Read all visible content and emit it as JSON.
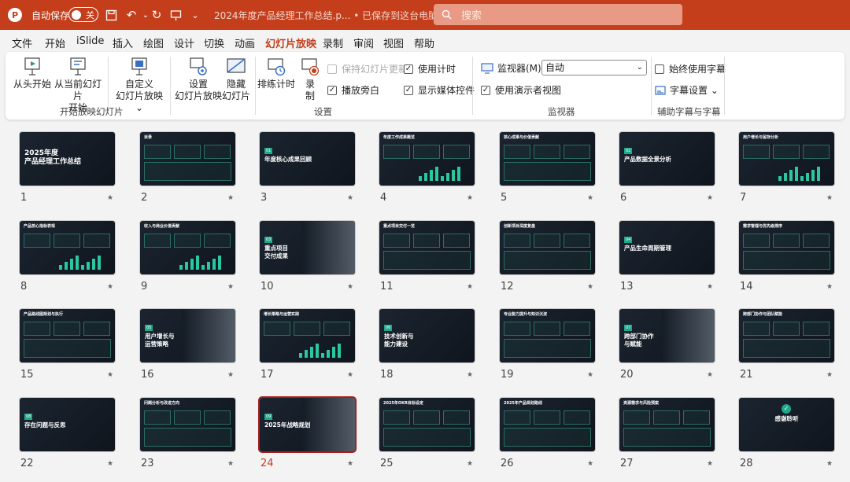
{
  "titlebar": {
    "autosave_label": "自动保存",
    "toggle_state": "关",
    "doc_title": "2024年度产品经理工作总结.p... • 已保存到这台电脑 ⌄",
    "search_placeholder": "搜索"
  },
  "menu": {
    "tabs": [
      "文件",
      "开始",
      "iSlide",
      "插入",
      "绘图",
      "设计",
      "切换",
      "动画",
      "幻灯片放映",
      "录制",
      "审阅",
      "视图",
      "帮助"
    ],
    "active": "幻灯片放映"
  },
  "ribbon": {
    "groups": {
      "start": {
        "label": "开始放映幻灯片",
        "from_beginning": "从头开始",
        "from_current_1": "从当前幻灯片",
        "from_current_2": "开始",
        "custom_1": "自定义",
        "custom_2": "幻灯片放映 ⌄"
      },
      "setup": {
        "label": "设置",
        "setup_show_1": "设置",
        "setup_show_2": "幻灯片放映",
        "hide_1": "隐藏",
        "hide_2": "幻灯片",
        "rehearse": "排练计时",
        "record_1": "录",
        "record_2": "制",
        "keep_updated": "保持幻灯片更新",
        "play_narration": "播放旁白",
        "use_timings": "使用计时",
        "show_media": "显示媒体控件"
      },
      "monitor": {
        "label": "监视器",
        "monitor_label": "监视器(M):",
        "monitor_value": "自动",
        "presenter_view": "使用演示者视图"
      },
      "captions": {
        "label": "辅助字幕与字幕",
        "always_captions": "始终使用字幕",
        "caption_settings": "字幕设置 ⌄"
      }
    }
  },
  "slides": [
    {
      "n": "1",
      "title": "2025年度\n产品经理工作总结",
      "kind": "cover"
    },
    {
      "n": "2",
      "title": "目录",
      "kind": "toc"
    },
    {
      "n": "3",
      "title": "年度核心成果回顾",
      "kind": "section",
      "badge": "01"
    },
    {
      "n": "4",
      "title": "年度工作成果概览",
      "kind": "data"
    },
    {
      "n": "5",
      "title": "核心成果与价值贡献",
      "kind": "panel"
    },
    {
      "n": "6",
      "title": "产品数据全景分析",
      "kind": "section",
      "badge": "02"
    },
    {
      "n": "7",
      "title": "用户增长与留存分析",
      "kind": "data"
    },
    {
      "n": "8",
      "title": "产品核心指标表现",
      "kind": "data"
    },
    {
      "n": "9",
      "title": "收入与商业价值贡献",
      "kind": "data"
    },
    {
      "n": "10",
      "title": "重点项目\n交付成果",
      "kind": "photo",
      "badge": "03"
    },
    {
      "n": "11",
      "title": "重点项目交付一览",
      "kind": "panel"
    },
    {
      "n": "12",
      "title": "创新项目深度复盘",
      "kind": "panel"
    },
    {
      "n": "13",
      "title": "产品生命周期管理",
      "kind": "section",
      "badge": "04"
    },
    {
      "n": "14",
      "title": "需求管理与优先级排序",
      "kind": "panel"
    },
    {
      "n": "15",
      "title": "产品路线图规划与执行",
      "kind": "panel"
    },
    {
      "n": "16",
      "title": "用户增长与\n运营策略",
      "kind": "photo",
      "badge": "05"
    },
    {
      "n": "17",
      "title": "增长策略与运营实践",
      "kind": "data"
    },
    {
      "n": "18",
      "title": "技术创新与\n能力建设",
      "kind": "section",
      "badge": "06"
    },
    {
      "n": "19",
      "title": "专业能力提升与知识沉淀",
      "kind": "panel"
    },
    {
      "n": "20",
      "title": "跨部门协作\n与赋能",
      "kind": "photo",
      "badge": "07"
    },
    {
      "n": "21",
      "title": "跨部门协作与团队赋能",
      "kind": "panel"
    },
    {
      "n": "22",
      "title": "存在问题与反思",
      "kind": "section",
      "badge": "08"
    },
    {
      "n": "23",
      "title": "问题分析与改进方向",
      "kind": "panel"
    },
    {
      "n": "24",
      "title": "2025年战略规划",
      "kind": "photo",
      "badge": "09"
    },
    {
      "n": "25",
      "title": "2025年OKR目标设定",
      "kind": "panel"
    },
    {
      "n": "26",
      "title": "2025年产品规划路线",
      "kind": "panel"
    },
    {
      "n": "27",
      "title": "资源需求与风险预案",
      "kind": "panel"
    },
    {
      "n": "28",
      "title": "感谢聆听",
      "kind": "end"
    }
  ],
  "selected_slide": "24",
  "star_glyph": "★"
}
